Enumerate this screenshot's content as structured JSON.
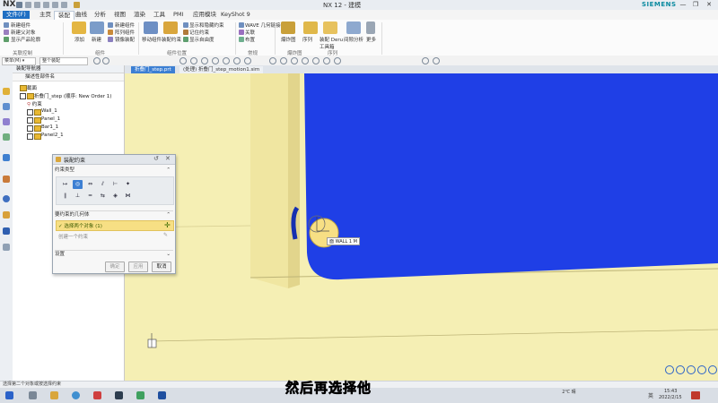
{
  "titlebar": {
    "app": "NX",
    "window_title": "NX 12 - 建模",
    "brand": "SIEMENS",
    "window_controls": [
      "—",
      "❐",
      "✕"
    ]
  },
  "menu": {
    "items": [
      "文件(F)",
      "主页",
      "装配",
      "曲线",
      "分析",
      "视图",
      "渲染",
      "工具",
      "PMI",
      "应用模块",
      "KeyShot 9"
    ]
  },
  "ribbon": {
    "items": [
      "新建组件",
      "新建父对象",
      "显示产品轮廓",
      "添加",
      "新建",
      "新建组件",
      "阵列组件",
      "镜像装配",
      "移动组件",
      "装配约束",
      "显示和隐藏约束",
      "记住约束",
      "显示自由度",
      "WAVE 几何链接器",
      "关联",
      "布置",
      "爆炸图",
      "序列",
      "装配 Deru 工具箱",
      "间隙分析",
      "更多"
    ],
    "groups": [
      "关联控制",
      "组件",
      "组件位置",
      "常规",
      "爆炸图",
      "序列"
    ]
  },
  "toolbar2": {
    "select_filter": "菜单(M) ▾",
    "select_scope": "整个装配"
  },
  "navigator": {
    "title": "装配导航器",
    "column": "描述性部件名",
    "tree": [
      "截面",
      "折叠门_step (顺序: New Order 1)",
      "约束",
      "Wall_1",
      "Panel_1",
      "Bar1_1",
      "Panel2_1"
    ]
  },
  "tabs": [
    "折叠门_step.prt",
    "(处理) 折叠门_step_motion1.sim"
  ],
  "dialog": {
    "title": "装配约束",
    "section_type": "约束类型",
    "type_icons": [
      "↦",
      "◎",
      "⇔",
      "⫽",
      "⊢",
      "✦",
      "∥",
      "⊥",
      "═",
      "⇆",
      "◈",
      "⋈"
    ],
    "section_geom": "要约束的几何体",
    "select_row": "✓ 选择两个对象 (1)",
    "create_row": "创建一个约束",
    "settings": "设置",
    "btn_ok": "确定",
    "btn_apply": "应用",
    "btn_cancel": "取消"
  },
  "viewport": {
    "object_label": "面 WALL 1 M"
  },
  "statusbar": {
    "text": "选择第二个对象或按选择约束"
  },
  "taskbar": {
    "weather": "2℃ 晴",
    "time": "15:43",
    "date": "2022/2/15",
    "lang": "英"
  },
  "subtitle": "然后再选择他",
  "colors": {
    "part_blue": "#1f3fe6",
    "part_yellow": "#f5efb4",
    "highlight": "#f7df84",
    "accent": "#1f6fc3"
  }
}
